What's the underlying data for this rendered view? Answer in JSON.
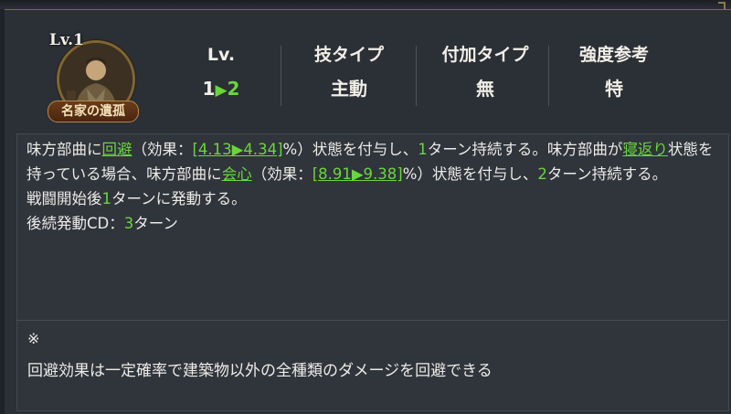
{
  "skill": {
    "level_badge": "Lv.1",
    "name": "名家の遺孤",
    "icon": "general-portrait-icon"
  },
  "stats": [
    {
      "label": "Lv.",
      "from": "1",
      "to": "2"
    },
    {
      "label": "技タイプ",
      "value": "主動"
    },
    {
      "label": "付加タイプ",
      "value": "無"
    },
    {
      "label": "強度参考",
      "value": "特"
    }
  ],
  "description": {
    "p1": {
      "t1": "味方部曲に",
      "kw1": "回避",
      "t2": "（効果：",
      "v1": "[4.13▶4.34]",
      "t3": "%）状態を付与し、",
      "n1": "1",
      "t4": "ターン持続する。味方部曲が",
      "kw2": "寝返り",
      "t5": "状態を持っている場合、味方部曲に",
      "kw3": "会心",
      "t6": "（効果：",
      "v2": "[8.91▶9.38]",
      "t7": "%）状態を付与し、",
      "n2": "2",
      "t8": "ターン持続する。"
    },
    "p2": {
      "t1": "戦闘開始後",
      "n": "1",
      "t2": "ターンに発動する。"
    },
    "p3": {
      "t1": "後続発動CD：",
      "n": "3",
      "t2": "ターン"
    }
  },
  "note": {
    "mark": "※",
    "text": "回避効果は一定確率で建築物以外の全種類のダメージを回避できる"
  },
  "colors": {
    "accent_green": "#6ad63c",
    "panel": "#30343b",
    "background": "#2b2f36"
  }
}
